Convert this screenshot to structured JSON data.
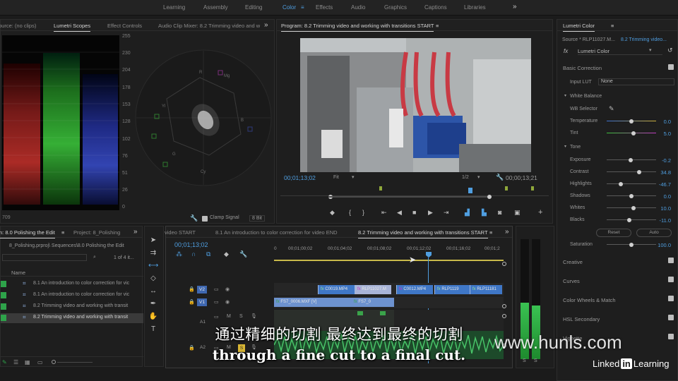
{
  "workspaces": {
    "tabs": [
      "Learning",
      "Assembly",
      "Editing",
      "Color",
      "Effects",
      "Audio",
      "Graphics",
      "Captions",
      "Libraries"
    ],
    "active": "Color",
    "more_icon": "double-chevron-right-icon"
  },
  "scopes_panel": {
    "tabs": [
      "Source: (no clips)",
      "Lumetri Scopes",
      "Effect Controls",
      "Audio Clip Mixer: 8.2 Trimming video and w"
    ],
    "active_tab": "Lumetri Scopes",
    "parade_scale": [
      "255",
      "230",
      "204",
      "178",
      "153",
      "128",
      "102",
      "76",
      "51",
      "26",
      "0"
    ],
    "vectorscope_labels": [
      "R",
      "Mg",
      "B",
      "Cy",
      "G",
      "Yl"
    ],
    "footer_left": "709",
    "clamp_signal_label": "Clamp Signal",
    "bit_depth": "8 Bit",
    "colors": {
      "red": "#c8322c",
      "green": "#38b238",
      "blue": "#3a4fd0"
    }
  },
  "program_monitor": {
    "title": "Program: 8.2 Trimming video and working with transitions START",
    "timecode": "00;01;13;02",
    "zoom": "Fit",
    "resolution": "1/2",
    "duration": "00;00;13;21",
    "accent": "#4f9ee0"
  },
  "lumetri_color": {
    "title": "Lumetri Color",
    "source": "Source * RLP11027.M...",
    "clip": "8.2 Trimming video...",
    "fx_label": "fx",
    "effect": "Lumetri Color",
    "basic_correction": "Basic Correction",
    "input_lut_label": "Input LUT",
    "input_lut": "None",
    "white_balance": "White Balance",
    "wb_selector": "WB Selector",
    "temperature": {
      "label": "Temperature",
      "value": "0.0",
      "level": 0.5
    },
    "tint": {
      "label": "Tint",
      "value": "5.0",
      "level": 0.53
    },
    "tone": "Tone",
    "sliders": [
      {
        "label": "Exposure",
        "value": "-0.2",
        "level": 0.49
      },
      {
        "label": "Contrast",
        "value": "34.8",
        "level": 0.67
      },
      {
        "label": "Highlights",
        "value": "-46.7",
        "level": 0.27
      },
      {
        "label": "Shadows",
        "value": "0.0",
        "level": 0.5
      },
      {
        "label": "Whites",
        "value": "10.0",
        "level": 0.55
      },
      {
        "label": "Blacks",
        "value": "-11.0",
        "level": 0.45
      }
    ],
    "reset": "Reset",
    "auto": "Auto",
    "saturation": {
      "label": "Saturation",
      "value": "100.0",
      "level": 0.5
    },
    "sections": [
      "Creative",
      "Curves",
      "Color Wheels & Match",
      "HSL Secondary",
      "Vignette"
    ]
  },
  "project_panel": {
    "tabs": [
      "n: 8.0 Polishing the Edit",
      "Project: 8_Polishing"
    ],
    "active_tab": "n: 8.0 Polishing the Edit",
    "path": "8_Polishing.prproj\\ Sequences\\8.0 Polishing the Edit",
    "count": "1 of 4 it...",
    "column_name": "Name",
    "items": [
      "8.1 An introduction to color correction for vic",
      "8.1 An introduction to color correction for vic",
      "8.2 Trimming video and working with transit",
      "8.2 Trimming video and working with transit"
    ],
    "selected_index": 3,
    "item_color": "#2ea34a"
  },
  "timeline": {
    "tabs": [
      "video START",
      "8.1 An introduction to color correction for video END",
      "8.2 Trimming video and working with transitions START"
    ],
    "active_tab": "8.2 Trimming video and working with transitions START",
    "timecode": "00;01;13;02",
    "ruler": [
      "0",
      "00;01;00;02",
      "00;01;04;02",
      "00;01;08;02",
      "00;01;12;02",
      "00;01;16;02",
      "00;01;2"
    ],
    "tracks": [
      "V2",
      "V1",
      "A1",
      "A2"
    ],
    "clips_v2": [
      "C0019.MP4",
      "RLP11027.M",
      "C0012.MP4",
      "RLP1119",
      "RLP11181"
    ],
    "clips_v1": [
      "FS7_0006.MXF [V]",
      "FS7_0"
    ],
    "playhead_fraction": 0.66
  },
  "audio_meter": {
    "s_labels": [
      "S",
      "S"
    ]
  },
  "subtitle": {
    "cn": "通过精细的切割 最终达到最终的切割",
    "en": "through a fine cut to a final cut."
  },
  "watermark": "www.hunls.com",
  "brand": {
    "name": "Linked",
    "in": "in",
    "learning": "Learning"
  }
}
